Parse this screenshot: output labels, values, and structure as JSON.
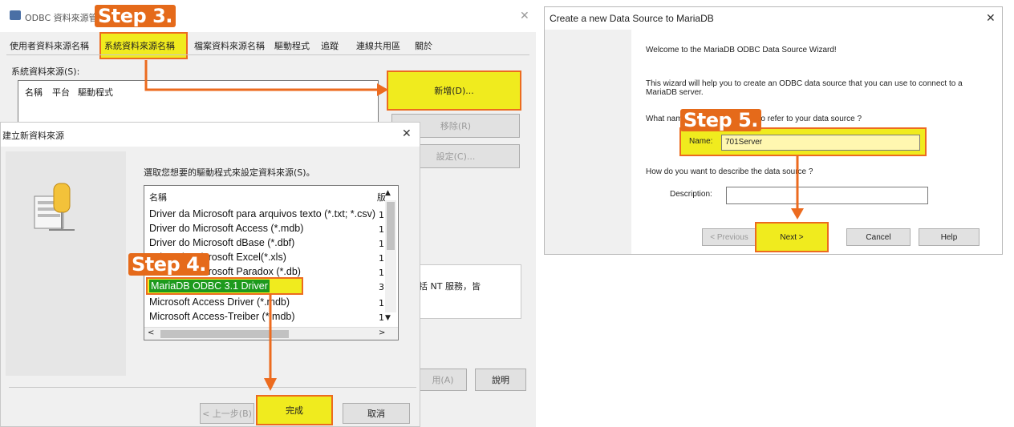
{
  "odbc_admin": {
    "title": "ODBC 資料來源管",
    "tabs": [
      "使用者資料來源名稱",
      "系統資料來源名稱",
      "檔案資料來源名稱",
      "驅動程式",
      "追蹤",
      "連線共用區",
      "關於"
    ],
    "system_dsn_label": "系統資料來源(S):",
    "columns": [
      "名稱",
      "平台",
      "驅動程式"
    ],
    "buttons": {
      "add": "新增(D)...",
      "remove": "移除(R)",
      "config": "設定(C)...",
      "apply": "用(A)",
      "help": "說明"
    },
    "desc_text": "書，包括 NT 服務，皆"
  },
  "create_dialog": {
    "title": "建立新資料來源",
    "prompt": "選取您想要的驅動程式來設定資料來源(S)。",
    "list_header_name": "名稱",
    "list_header_ver": "版",
    "drivers": [
      {
        "name": "Driver da Microsoft para arquivos texto (*.txt; *.csv)",
        "ver": "1"
      },
      {
        "name": "Driver do Microsoft Access (*.mdb)",
        "ver": "1"
      },
      {
        "name": "Driver do Microsoft dBase (*.dbf)",
        "ver": "1"
      },
      {
        "name": "Driver do Microsoft Excel(*.xls)",
        "ver": "1"
      },
      {
        "name": "Driver da Microsoft Paradox (*.db)",
        "ver": "1"
      },
      {
        "name": "MariaDB ODBC 3.1 Driver",
        "ver": "3"
      },
      {
        "name": "Microsoft Access Driver (*.mdb)",
        "ver": "1"
      },
      {
        "name": "Microsoft Access-Treiber (*.mdb)",
        "ver": "1"
      }
    ],
    "buttons": {
      "back": "< 上一步(B)",
      "finish": "完成",
      "cancel": "取消"
    }
  },
  "mariadb_wizard": {
    "title": "Create a new Data Source to MariaDB",
    "welcome": "Welcome to the MariaDB ODBC Data Source Wizard!",
    "intro": "This wizard will help you to create an ODBC data source that you can use to connect to a MariaDB server.",
    "name_question": "What name do you want to use to refer to your data source ?",
    "name_label": "Name:",
    "name_value": "701Server",
    "desc_question": "How do you want to describe the data source ?",
    "desc_label": "Description:",
    "desc_value": "",
    "buttons": {
      "previous": "< Previous",
      "next": "Next >",
      "cancel": "Cancel",
      "help": "Help"
    }
  },
  "steps": {
    "s3": "Step 3.",
    "s4": "Step 4.",
    "s5": "Step 5."
  },
  "colors": {
    "highlight": "#f0eb1e",
    "accent": "#ec6b1f",
    "selected": "#1d9a1d"
  }
}
